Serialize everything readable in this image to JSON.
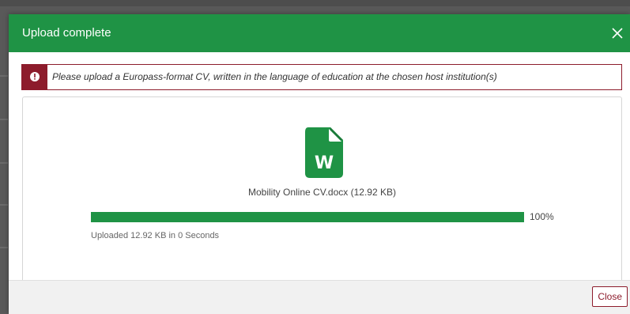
{
  "dialog": {
    "title": "Upload complete",
    "close_icon": "close-icon",
    "header_color": "#1f9345"
  },
  "notice": {
    "icon": "info-icon",
    "text": "Please upload a Europass-format CV, written in the language of education at the chosen host institution(s)",
    "accent_color": "#8d1c2c"
  },
  "upload": {
    "file_icon": "word-document-icon",
    "file_name": "Mobility Online CV.docx (12.92 KB)",
    "progress_fraction": 1.0,
    "progress_label": "100%",
    "caption": "Uploaded 12.92 KB in 0 Seconds"
  },
  "footer": {
    "close_label": "Close"
  }
}
